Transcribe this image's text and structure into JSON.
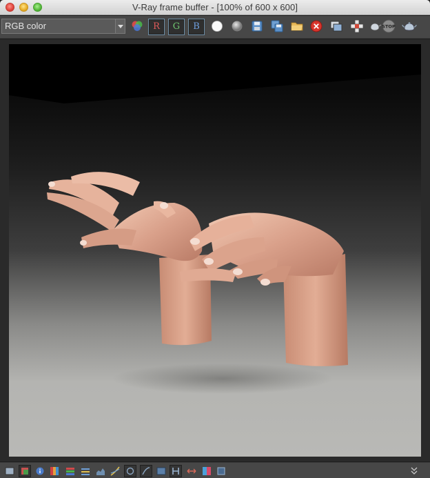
{
  "window": {
    "title": "V-Ray frame buffer - [100% of 600 x 600]"
  },
  "toolbar": {
    "channel": {
      "selected": "RGB color"
    },
    "channel_buttons": {
      "r": "R",
      "g": "G",
      "b": "B"
    },
    "icons": [
      "color-channels-icon",
      "show-white-icon",
      "show-gray-icon",
      "save-image-icon",
      "save-all-icons",
      "open-image-icon",
      "clear-image-icon",
      "duplicate-to-max-icon",
      "track-mouse-icon",
      "region-render-icon",
      "stop-render-icon",
      "render-teapot-icon"
    ]
  },
  "bottombar": {
    "icons": [
      "display-correction-icon",
      "color-corrections-icon",
      "info-icon",
      "lut-icon",
      "channel-colors-icon",
      "levels-icon",
      "histogram-icon",
      "curve-icon",
      "exposure-icon",
      "srgb-icon",
      "ocio-icon",
      "histogram-h-icon",
      "compare-icon",
      "ab-compare-icon",
      "pixel-aspect-icon",
      "expand-icon"
    ]
  },
  "colors": {
    "toolbar_bg": "#474747",
    "viewport_bg": "#2a2a2a",
    "channel_r": "#e05a5a",
    "channel_g": "#6fc56f",
    "channel_b": "#6f9fe0"
  }
}
